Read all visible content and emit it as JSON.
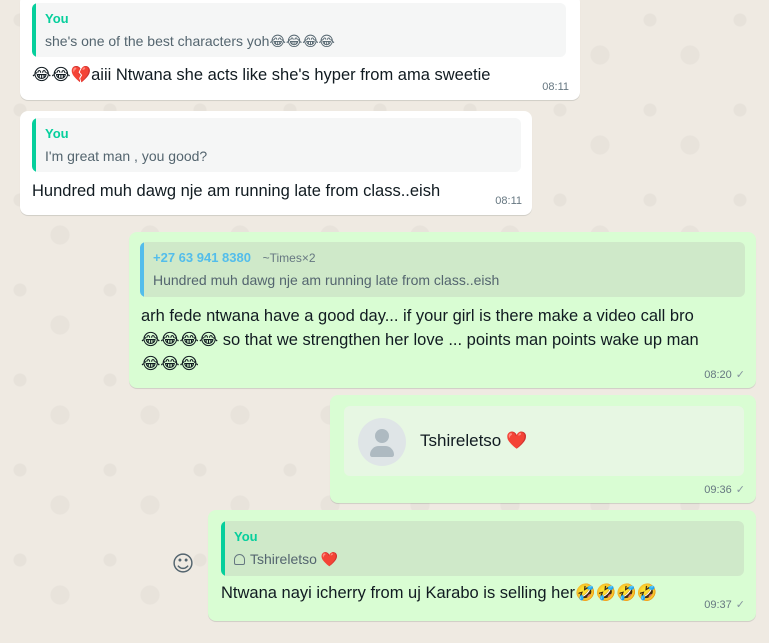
{
  "messages": [
    {
      "quote_author": "You",
      "quote_text": "she's one of the best characters yoh😂😂😂😂",
      "text": "😂😂💔aiii Ntwana she acts like she's hyper from ama sweetie",
      "time": "08:11"
    },
    {
      "quote_author": "You",
      "quote_text": "I'm great man , you good?",
      "text": "Hundred muh dawg nje am running late from class..eish",
      "time": "08:11"
    },
    {
      "quote_author": "+27 63 941 8380",
      "quote_name": "~Times×2",
      "quote_text": "Hundred muh dawg nje am running late from class..eish",
      "text_line1": "arh fede ntwana have a good day... if your girl is there make a video call bro",
      "text_line2": "😂😂😂😂 so that we strengthen her love ... points man points wake up man",
      "text_line3": "😂😂😂",
      "time": "08:20"
    },
    {
      "contact_name": "Tshireletso",
      "heart": "❤️",
      "time": "09:36"
    },
    {
      "quote_author": "You",
      "quote_text": "Tshireletso",
      "quote_heart": "❤️",
      "text": "Ntwana nayi icherry from uj Karabo is selling her🤣🤣🤣🤣",
      "time": "09:37"
    }
  ],
  "colors": {
    "you_accent": "#06cf9c",
    "other_accent": "#53bdeb",
    "outgoing_bubble": "#d9fdd3",
    "incoming_bubble": "#ffffff",
    "chat_background": "#efeae2"
  },
  "icons": {
    "tick": "✓",
    "emoji_button": "☺"
  }
}
